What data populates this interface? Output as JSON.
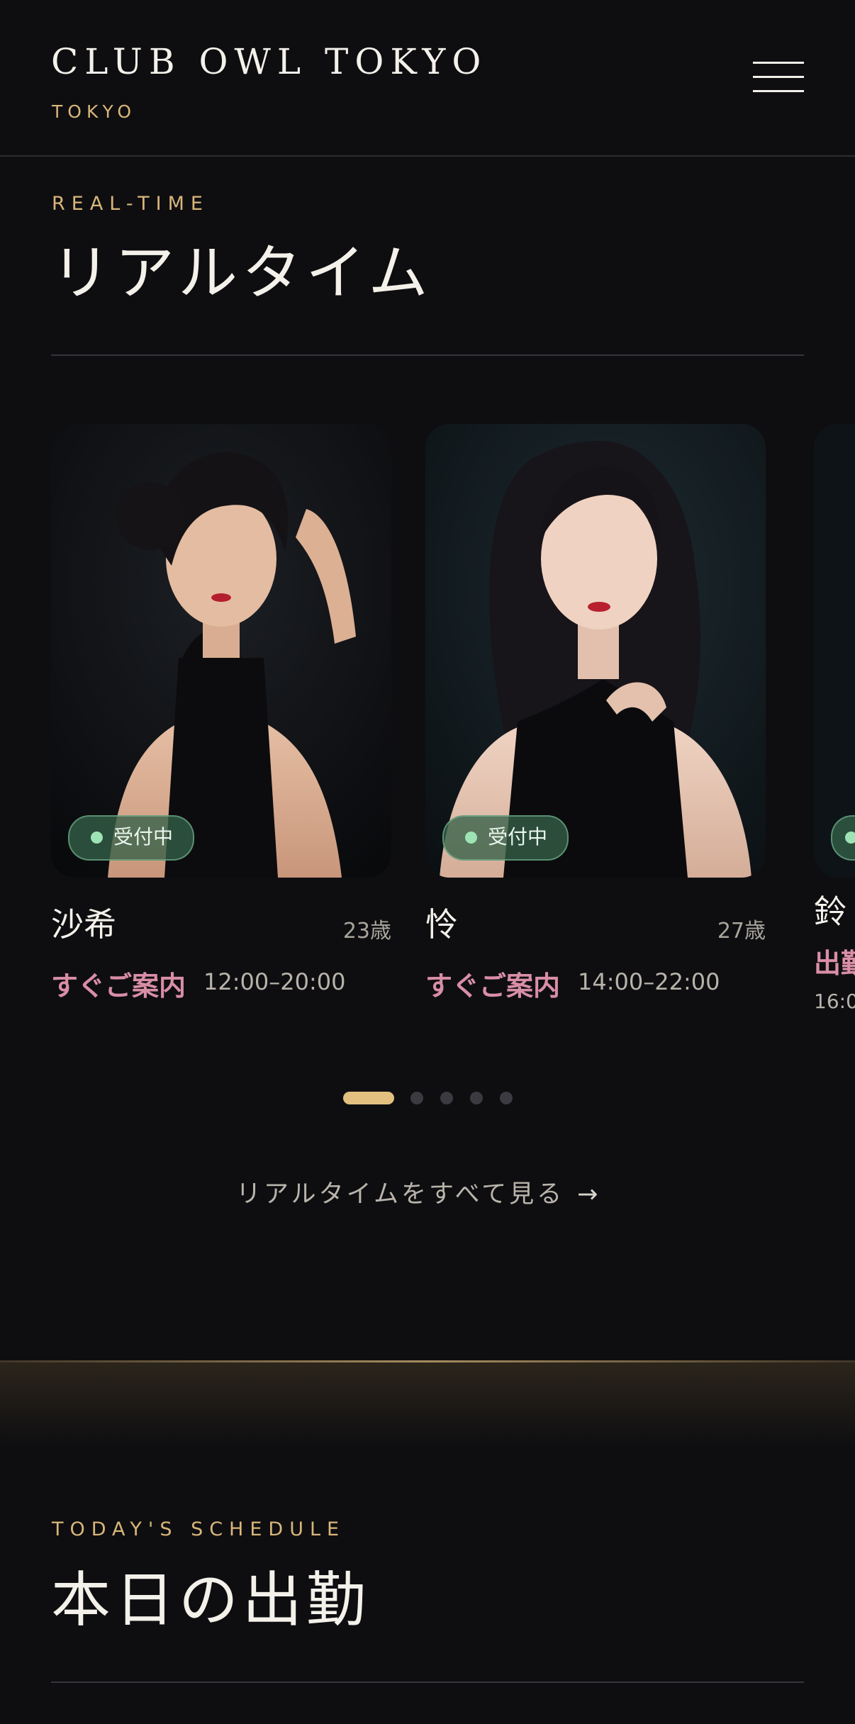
{
  "header": {
    "brand_title": "CLUB OWL TOKYO",
    "brand_subtitle": "TOKYO",
    "menu_icon": "hamburger-menu-icon"
  },
  "realtime": {
    "eyebrow": "REAL-TIME",
    "title": "リアルタイム",
    "cards": [
      {
        "name": "沙希",
        "age": "23歳",
        "badge": "受付中",
        "status": "すぐご案内",
        "time": "12:00–20:00"
      },
      {
        "name": "怜",
        "age": "27歳",
        "badge": "受付中",
        "status": "すぐご案内",
        "time": "14:00–22:00"
      },
      {
        "name": "鈴",
        "age": "",
        "badge": "",
        "status": "出勤",
        "time": "16:0"
      }
    ],
    "pagination": {
      "count": 5,
      "active_index": 0
    },
    "view_all_label": "リアルタイムをすべて見る",
    "view_all_arrow": "→"
  },
  "schedule": {
    "eyebrow": "TODAY'S SCHEDULE",
    "title": "本日の出勤"
  },
  "colors": {
    "background": "#0e0e11",
    "gold_accent": "#d9b679",
    "pink_status": "#d98ea6",
    "badge_green": "#9ee3b4"
  }
}
